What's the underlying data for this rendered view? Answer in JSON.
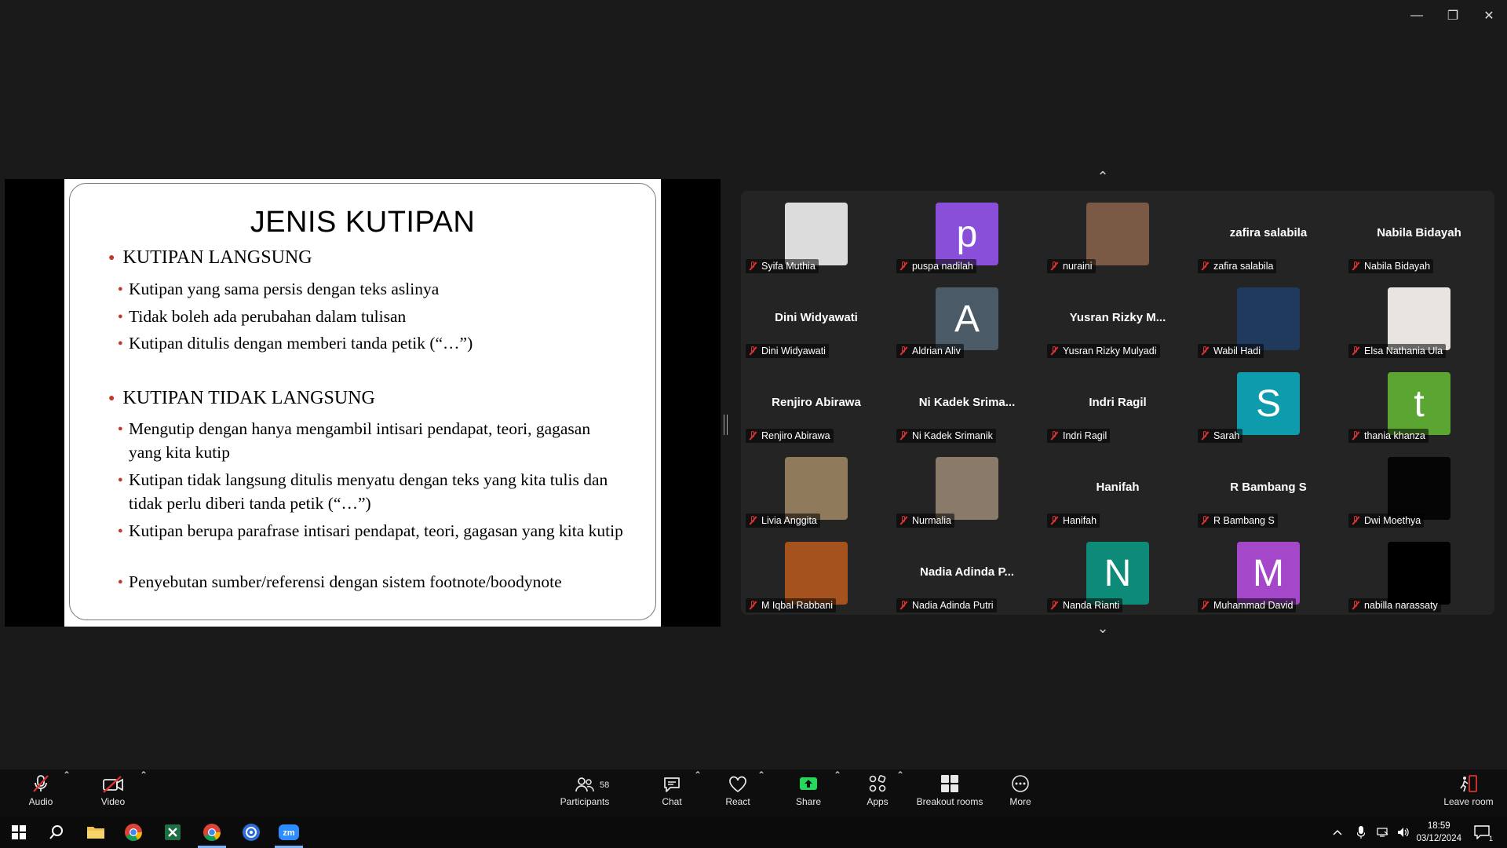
{
  "window": {
    "minimize_icon": "minimize-icon",
    "restore_icon": "restore-icon",
    "close_icon": "close-icon"
  },
  "slide": {
    "title": "JENIS KUTIPAN",
    "sections": [
      {
        "heading": "KUTIPAN LANGSUNG",
        "items": [
          "Kutipan yang sama persis dengan teks aslinya",
          "Tidak boleh ada perubahan dalam tulisan",
          "Kutipan ditulis dengan memberi tanda petik (“…”)"
        ]
      },
      {
        "heading": "KUTIPAN TIDAK LANGSUNG",
        "items": [
          "Mengutip dengan hanya mengambil intisari pendapat, teori, gagasan yang kita kutip",
          "Kutipan tidak langsung ditulis menyatu dengan teks yang kita tulis dan tidak perlu diberi tanda petik (“…”)",
          "Kutipan berupa parafrase intisari pendapat, teori, gagasan yang kita kutip",
          "Penyebutan sumber/referensi dengan sistem footnote/boodynote"
        ]
      }
    ]
  },
  "gallery": {
    "participants": [
      {
        "label": "Syifa Muthia",
        "type": "photo",
        "color": "#dcdcdc"
      },
      {
        "label": "puspa nadilah",
        "type": "letter",
        "letter": "p",
        "color": "#8a4fd8"
      },
      {
        "label": "nuraini",
        "type": "photo",
        "color": "#7a5a44"
      },
      {
        "label": "zafira salabila",
        "type": "name",
        "big": "zafira salabila"
      },
      {
        "label": "Nabila Bidayah",
        "type": "name",
        "big": "Nabila Bidayah"
      },
      {
        "label": "Dini Widyawati",
        "type": "name",
        "big": "Dini Widyawati"
      },
      {
        "label": "Aldrian Aliv",
        "type": "letter",
        "letter": "A",
        "color": "#4a5a66"
      },
      {
        "label": "Yusran Rizky Mulyadi",
        "type": "name",
        "big": "Yusran  Rizky  M..."
      },
      {
        "label": "Wabil Hadi",
        "type": "photo",
        "color": "#1f3a5c"
      },
      {
        "label": "Elsa Nathania Ula",
        "type": "photo",
        "color": "#e8e4e0"
      },
      {
        "label": "Renjiro Abirawa",
        "type": "name",
        "big": "Renjiro Abirawa"
      },
      {
        "label": "Ni Kadek Srimanik",
        "type": "name",
        "big": "Ni  Kadek  Srima..."
      },
      {
        "label": "Indri Ragil",
        "type": "name",
        "big": "Indri Ragil"
      },
      {
        "label": "Sarah",
        "type": "letter",
        "letter": "S",
        "color": "#0e9cad"
      },
      {
        "label": "thania khanza",
        "type": "letter",
        "letter": "t",
        "color": "#5ba632"
      },
      {
        "label": "Livia Anggita",
        "type": "photo",
        "color": "#8f7a5c"
      },
      {
        "label": "Nurmalia",
        "type": "photo",
        "color": "#8a7a6a"
      },
      {
        "label": "Hanifah",
        "type": "name",
        "big": "Hanifah"
      },
      {
        "label": "R Bambang S",
        "type": "name",
        "big": "R Bambang S"
      },
      {
        "label": "Dwi Moethya",
        "type": "photo",
        "color": "#050505"
      },
      {
        "label": "M Iqbal Rabbani",
        "type": "photo",
        "color": "#a5521e"
      },
      {
        "label": "Nadia Adinda Putri",
        "type": "name",
        "big": "Nadia  Adinda  P..."
      },
      {
        "label": "Nanda Rianti",
        "type": "letter",
        "letter": "N",
        "color": "#0e8a78"
      },
      {
        "label": "Muhammad David",
        "type": "letter",
        "letter": "M",
        "color": "#a447c9"
      },
      {
        "label": "nabilla narassaty",
        "type": "photo",
        "color": "#000000"
      }
    ],
    "scroll_up_icon": "chevron-up-icon",
    "scroll_down_icon": "chevron-down-icon"
  },
  "toolbar": {
    "audio": "Audio",
    "video": "Video",
    "participants": "Participants",
    "participants_count": "58",
    "chat": "Chat",
    "react": "React",
    "share": "Share",
    "apps": "Apps",
    "breakout": "Breakout rooms",
    "more": "More",
    "leave": "Leave room",
    "share_color": "#23d959"
  },
  "taskbar": {
    "time": "18:59",
    "date": "03/12/2024",
    "notification_count": "1"
  }
}
